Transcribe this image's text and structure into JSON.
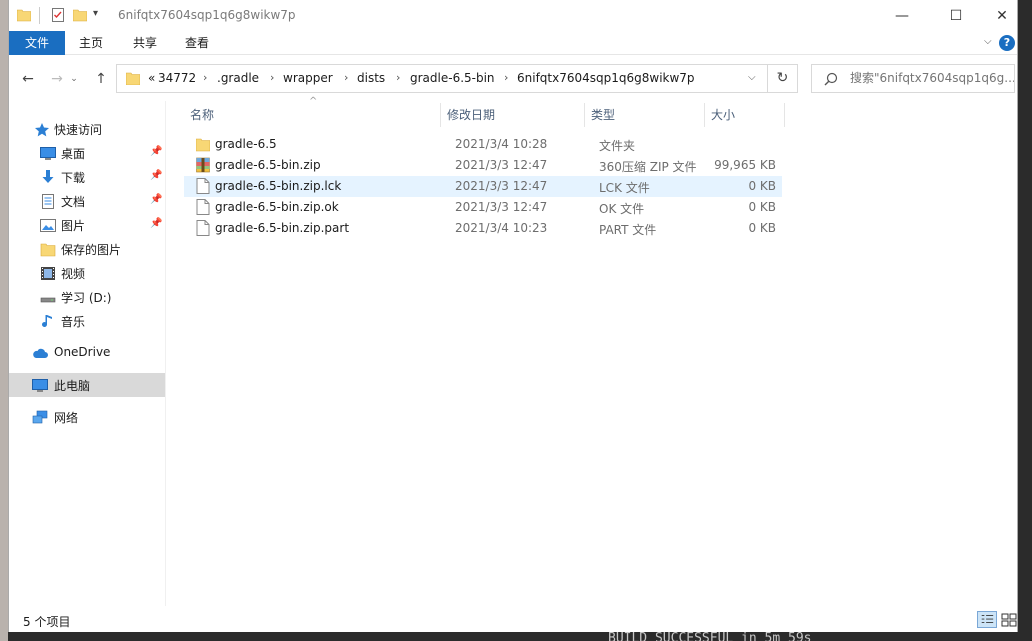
{
  "title": "6nifqtx7604sqp1q6g8wikw7p",
  "window_controls": {
    "minimize": "—",
    "maximize": "☐",
    "close": "✕"
  },
  "ribbon": {
    "tabs": [
      "文件",
      "主页",
      "共享",
      "查看"
    ],
    "help": "?"
  },
  "navbar": {
    "breadcrumb_prefix": "«",
    "breadcrumb": [
      "34772",
      ".gradle",
      "wrapper",
      "dists",
      "gradle-6.5-bin",
      "6nifqtx7604sqp1q6g8wikw7p"
    ],
    "search_placeholder": "搜索\"6nifqtx7604sqp1q6g..."
  },
  "sidebar": {
    "quick_access": "快速访问",
    "items": [
      {
        "label": "桌面",
        "icon": "desktop-icon",
        "pinned": true
      },
      {
        "label": "下载",
        "icon": "download-icon",
        "pinned": true
      },
      {
        "label": "文档",
        "icon": "document-icon",
        "pinned": true
      },
      {
        "label": "图片",
        "icon": "pictures-icon",
        "pinned": true
      },
      {
        "label": "保存的图片",
        "icon": "folder-icon",
        "pinned": false
      },
      {
        "label": "视频",
        "icon": "video-icon",
        "pinned": false
      },
      {
        "label": "学习 (D:)",
        "icon": "drive-icon",
        "pinned": false
      },
      {
        "label": "音乐",
        "icon": "music-icon",
        "pinned": false
      }
    ],
    "onedrive": "OneDrive",
    "this_pc": "此电脑",
    "network": "网络"
  },
  "columns": {
    "name": "名称",
    "date": "修改日期",
    "type": "类型",
    "size": "大小"
  },
  "files": [
    {
      "name": "gradle-6.5",
      "date": "2021/3/4 10:28",
      "type": "文件夹",
      "size": "",
      "icon": "folder-icon"
    },
    {
      "name": "gradle-6.5-bin.zip",
      "date": "2021/3/3 12:47",
      "type": "360压缩 ZIP 文件",
      "size": "99,965 KB",
      "icon": "zip-archive-icon"
    },
    {
      "name": "gradle-6.5-bin.zip.lck",
      "date": "2021/3/3 12:47",
      "type": "LCK 文件",
      "size": "0 KB",
      "icon": "file-icon"
    },
    {
      "name": "gradle-6.5-bin.zip.ok",
      "date": "2021/3/3 12:47",
      "type": "OK 文件",
      "size": "0 KB",
      "icon": "file-icon"
    },
    {
      "name": "gradle-6.5-bin.zip.part",
      "date": "2021/3/4 10:23",
      "type": "PART 文件",
      "size": "0 KB",
      "icon": "file-icon"
    }
  ],
  "status": {
    "count": "5 个项目"
  },
  "background": {
    "terminal_text": "BUILD SUCCESSFUL in 5m 59s"
  },
  "colors": {
    "accent": "#1a6ec1",
    "selected_row": "#e5f3ff",
    "folder": "#f8d775"
  }
}
